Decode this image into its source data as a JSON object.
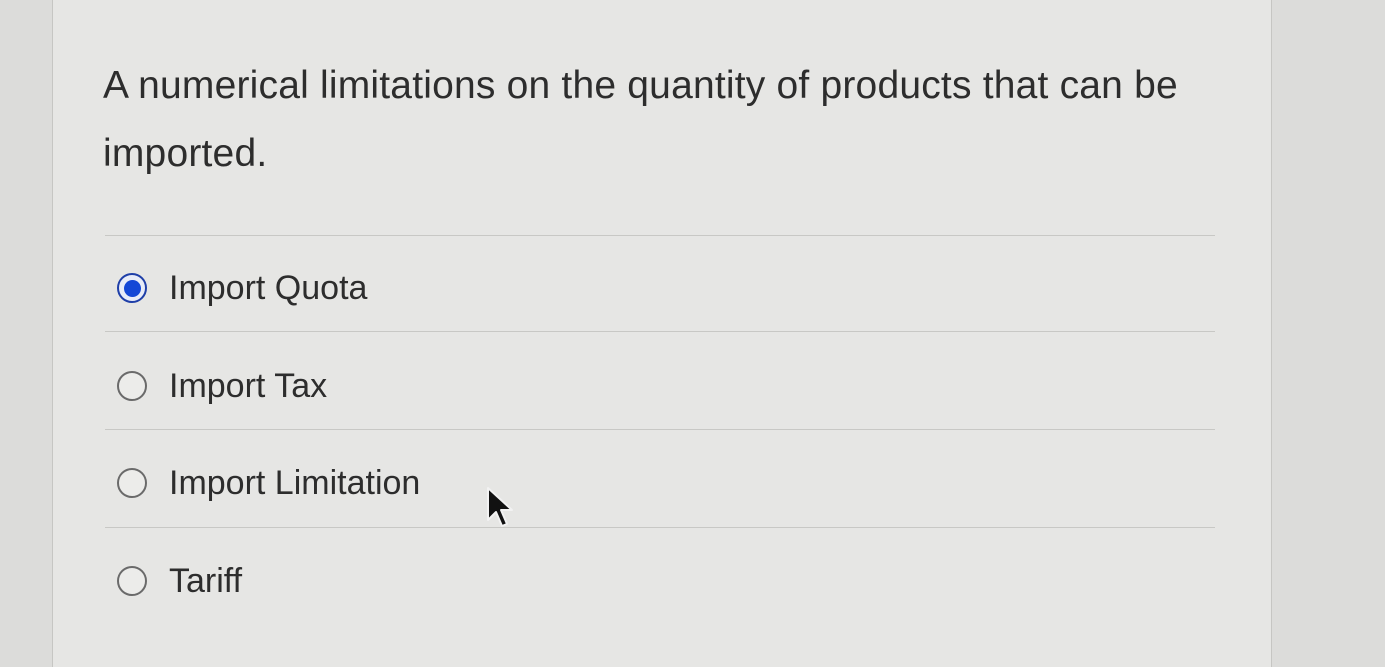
{
  "question": {
    "text": "A numerical limitations on the quantity of products that can be imported."
  },
  "options": [
    {
      "label": "Import Quota",
      "selected": true
    },
    {
      "label": "Import Tax",
      "selected": false
    },
    {
      "label": "Import Limitation",
      "selected": false
    },
    {
      "label": "Tariff",
      "selected": false
    }
  ],
  "colors": {
    "selected_radio": "#1447d6",
    "text": "#2d2d2d",
    "background": "#e6e6e4"
  },
  "icons": {
    "pointer": "arrow-cursor-icon"
  }
}
